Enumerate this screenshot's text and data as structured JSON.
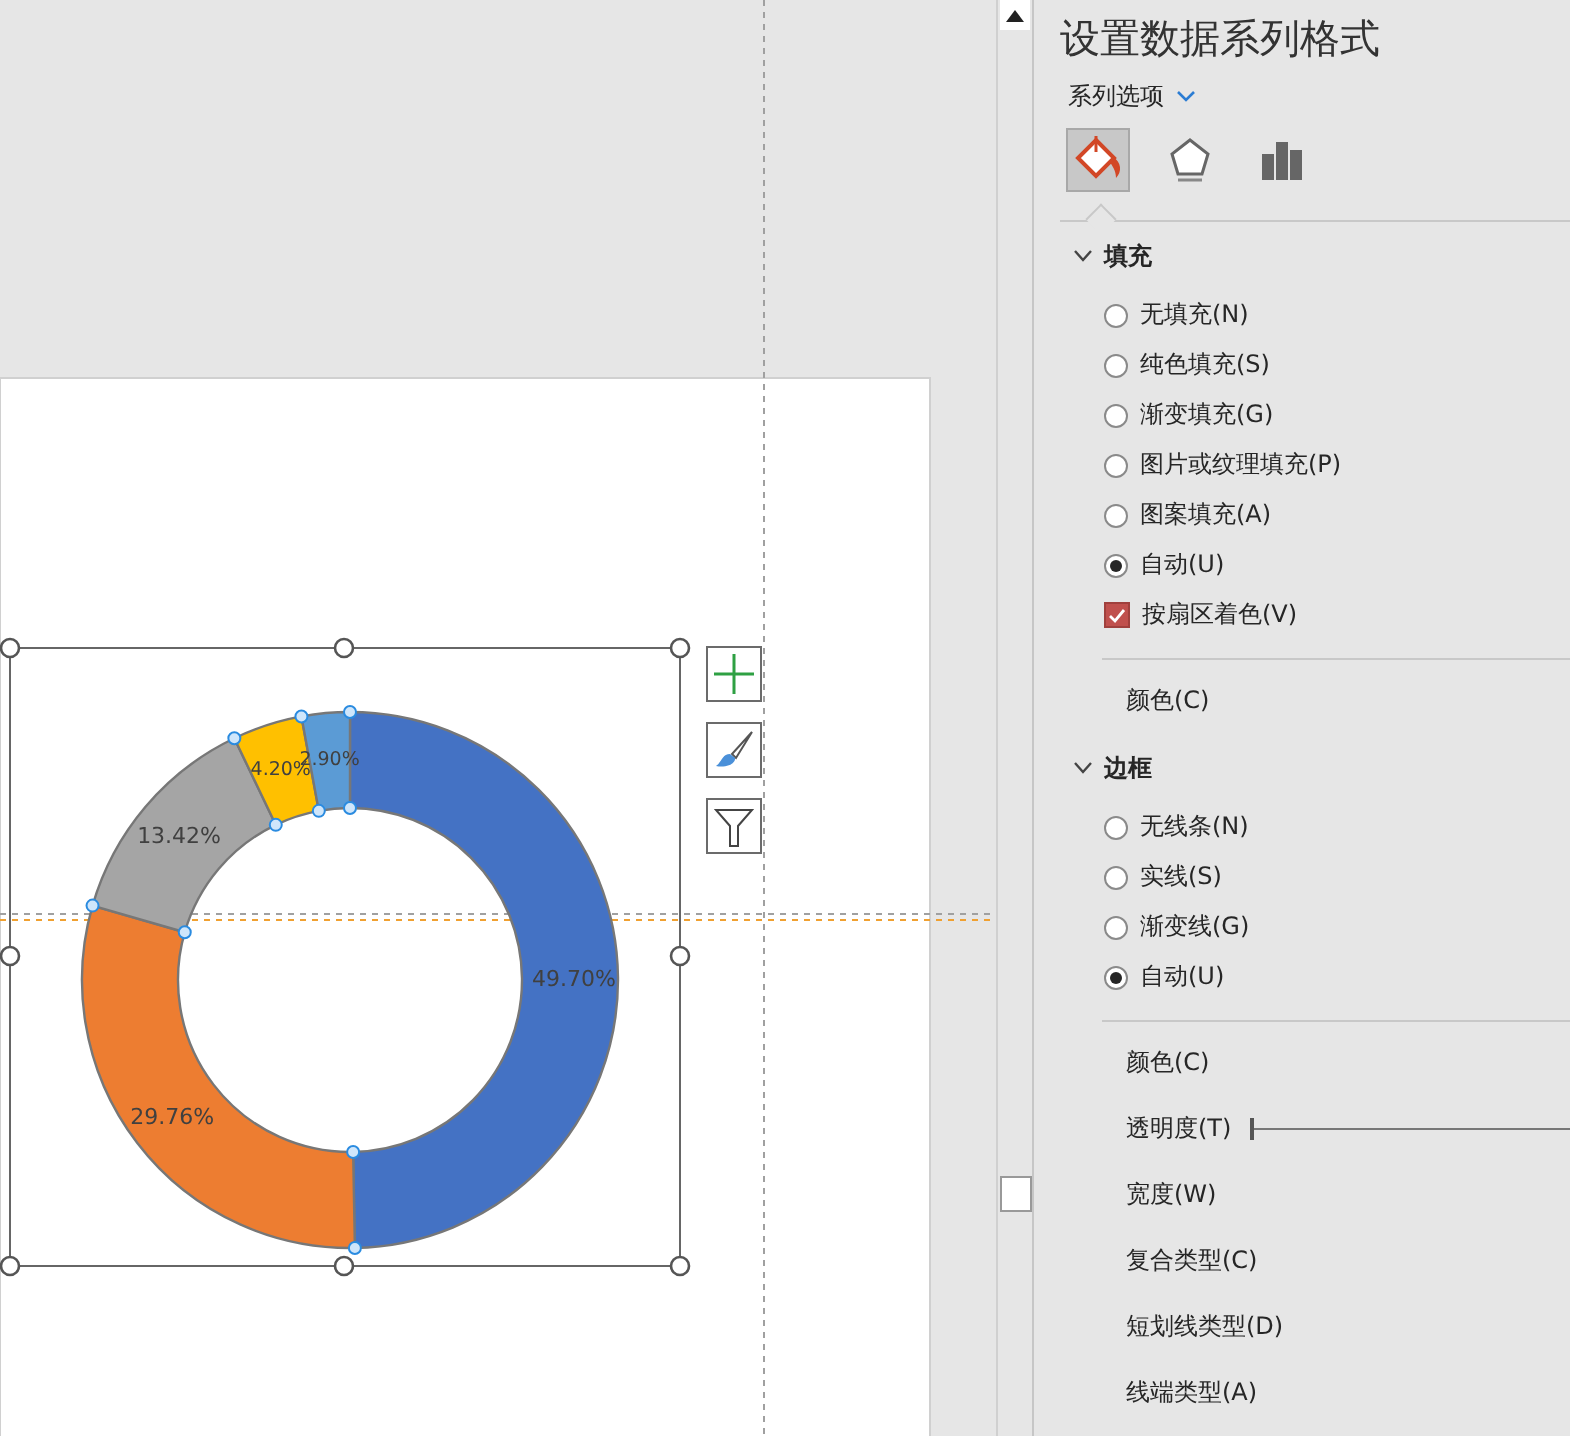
{
  "chart": {
    "chart_data": {
      "type": "donut",
      "values": [
        49.7,
        29.76,
        13.42,
        4.2,
        2.9
      ],
      "colors": [
        "#4472c4",
        "#ed7d31",
        "#a5a5a5",
        "#ffc000",
        "#5b9bd5"
      ],
      "data_labels": true,
      "value_labels": [
        "49.70%",
        "29.76%",
        "13.42%",
        "4.20%",
        "2.90%"
      ]
    }
  },
  "pane": {
    "title": "设置数据系列格式",
    "options_menu": "系列选项",
    "tabs": [
      {
        "kind": "fill",
        "selected": true
      },
      {
        "kind": "effects",
        "selected": false
      },
      {
        "kind": "series",
        "selected": false
      }
    ],
    "sections": [
      {
        "title": "填充",
        "expanded": true,
        "options": [
          {
            "kind": "radio",
            "label": "无填充(N)",
            "selected": false
          },
          {
            "kind": "radio",
            "label": "纯色填充(S)",
            "selected": false
          },
          {
            "kind": "radio",
            "label": "渐变填充(G)",
            "selected": false
          },
          {
            "kind": "radio",
            "label": "图片或纹理填充(P)",
            "selected": false
          },
          {
            "kind": "radio",
            "label": "图案填充(A)",
            "selected": false
          },
          {
            "kind": "radio",
            "label": "自动(U)",
            "selected": true
          },
          {
            "kind": "checkbox",
            "label": "按扇区着色(V)",
            "checked": true
          }
        ],
        "properties": [
          {
            "kind": "label",
            "label": "颜色(C)"
          }
        ]
      },
      {
        "title": "边框",
        "expanded": true,
        "options": [
          {
            "kind": "radio",
            "label": "无线条(N)",
            "selected": false
          },
          {
            "kind": "radio",
            "label": "实线(S)",
            "selected": false
          },
          {
            "kind": "radio",
            "label": "渐变线(G)",
            "selected": false
          },
          {
            "kind": "radio",
            "label": "自动(U)",
            "selected": true
          }
        ],
        "properties": [
          {
            "kind": "label",
            "label": "颜色(C)"
          },
          {
            "kind": "slider",
            "label": "透明度(T)",
            "level": 0
          },
          {
            "kind": "label",
            "label": "宽度(W)"
          },
          {
            "kind": "label",
            "label": "复合类型(C)"
          },
          {
            "kind": "label",
            "label": "短划线类型(D)"
          },
          {
            "kind": "label",
            "label": "线端类型(A)"
          }
        ]
      }
    ]
  }
}
